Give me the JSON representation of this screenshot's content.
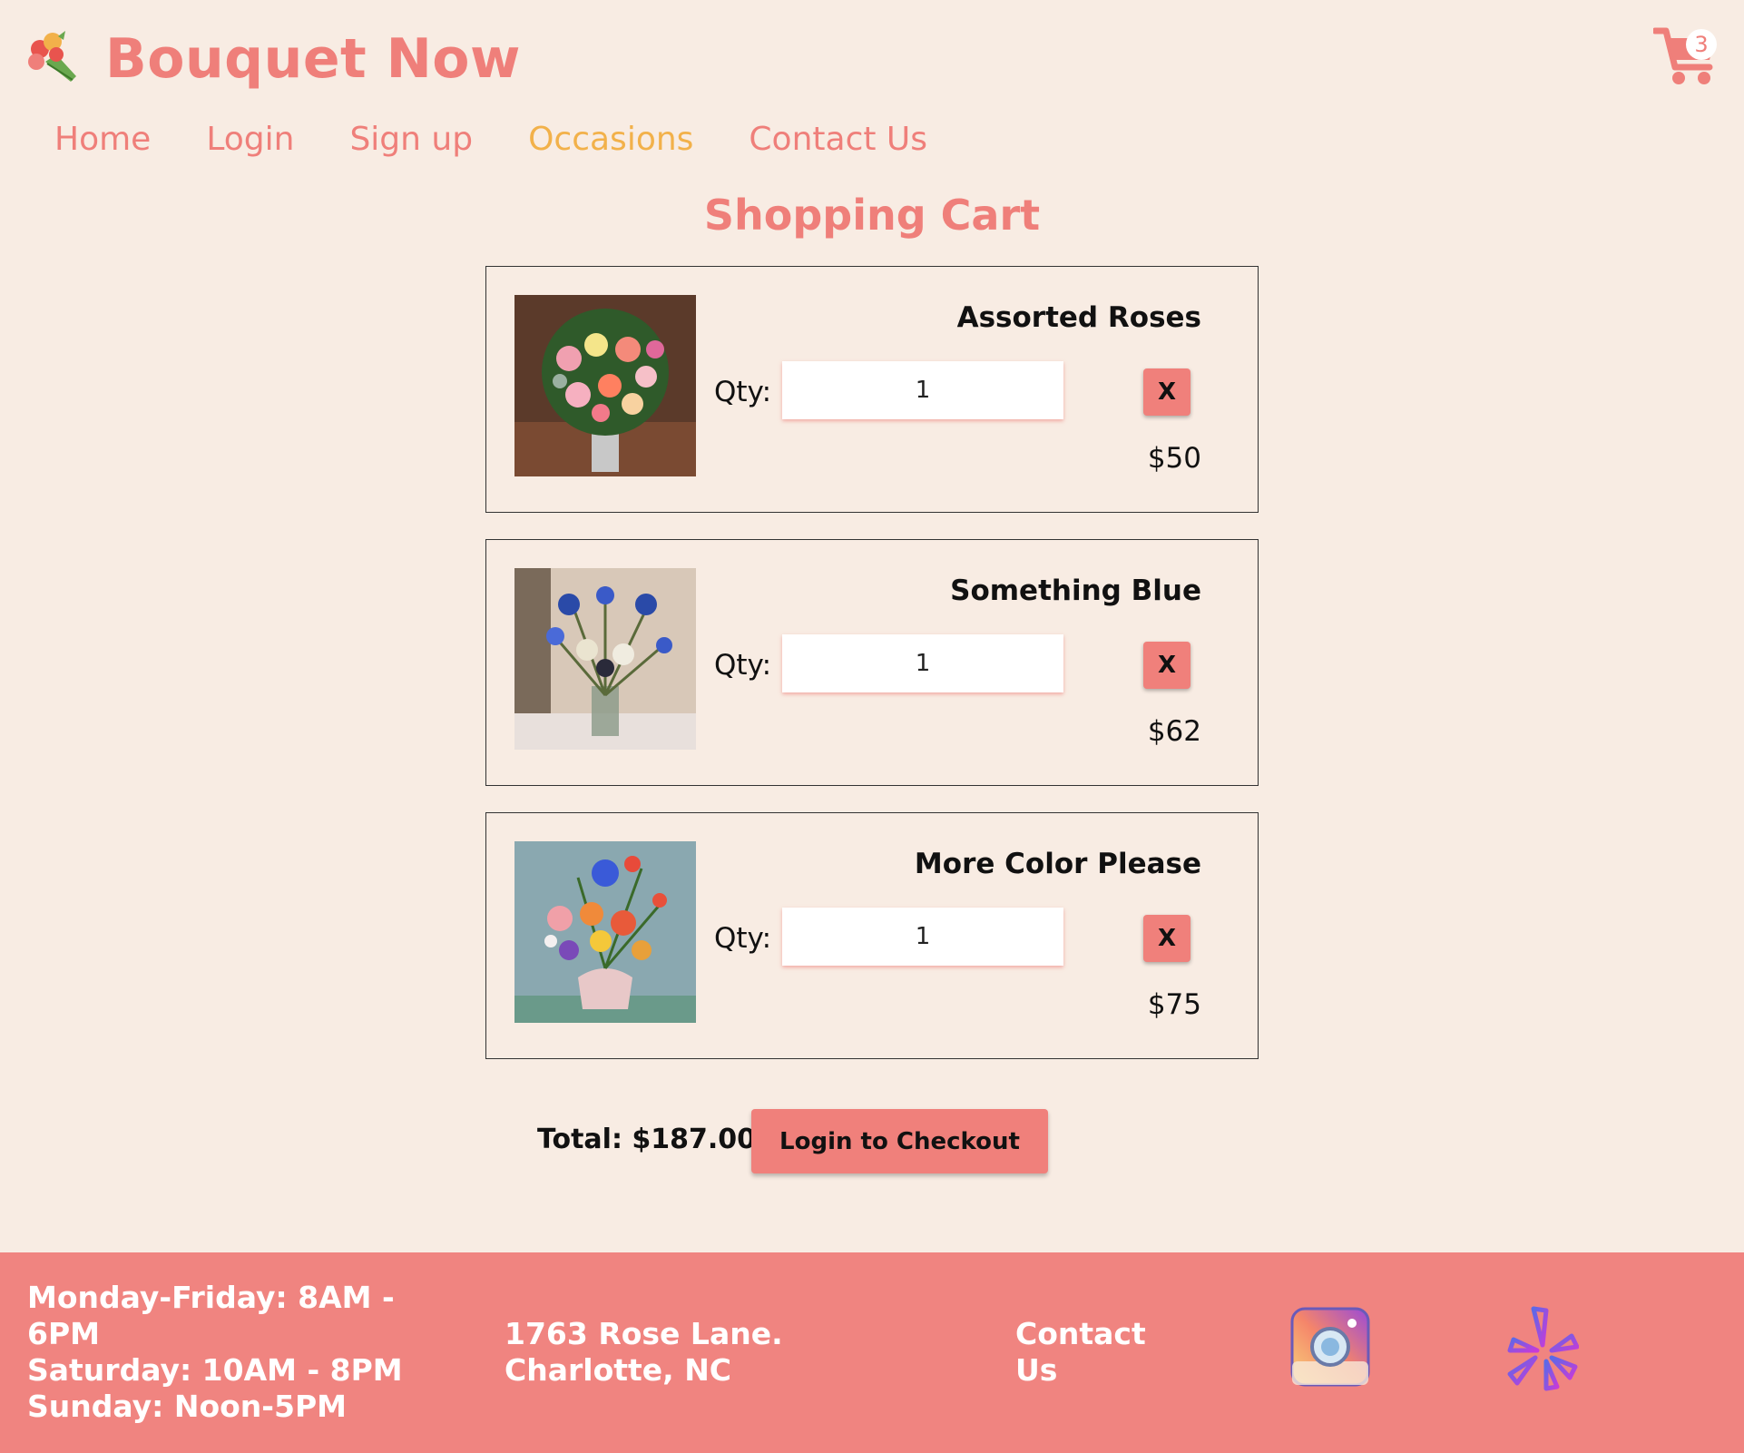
{
  "header": {
    "brand": "Bouquet Now",
    "cart_count": "3"
  },
  "nav": [
    {
      "label": "Home"
    },
    {
      "label": "Login"
    },
    {
      "label": "Sign up"
    },
    {
      "label": "Occasions",
      "active": true
    },
    {
      "label": "Contact Us"
    }
  ],
  "page_title": "Shopping Cart",
  "cart": {
    "qty_label": "Qty:",
    "remove_label": "X",
    "items": [
      {
        "name": "Assorted Roses",
        "qty": "1",
        "price": "$50"
      },
      {
        "name": "Something Blue",
        "qty": "1",
        "price": "$62"
      },
      {
        "name": "More Color Please",
        "qty": "1",
        "price": "$75"
      }
    ],
    "total": "Total: $187.00",
    "checkout_label": "Login to Checkout"
  },
  "footer": {
    "hours": [
      "Monday-Friday: 8AM - 6PM",
      "Saturday: 10AM - 8PM",
      "Sunday: Noon-5PM"
    ],
    "address": [
      "1763 Rose Lane.",
      "Charlotte, NC"
    ],
    "contact": "Contact Us"
  },
  "colors": {
    "background": "#f8ece3",
    "accent": "#ef7f7a",
    "active_nav": "#f2b14a",
    "footer": "#f08480"
  }
}
